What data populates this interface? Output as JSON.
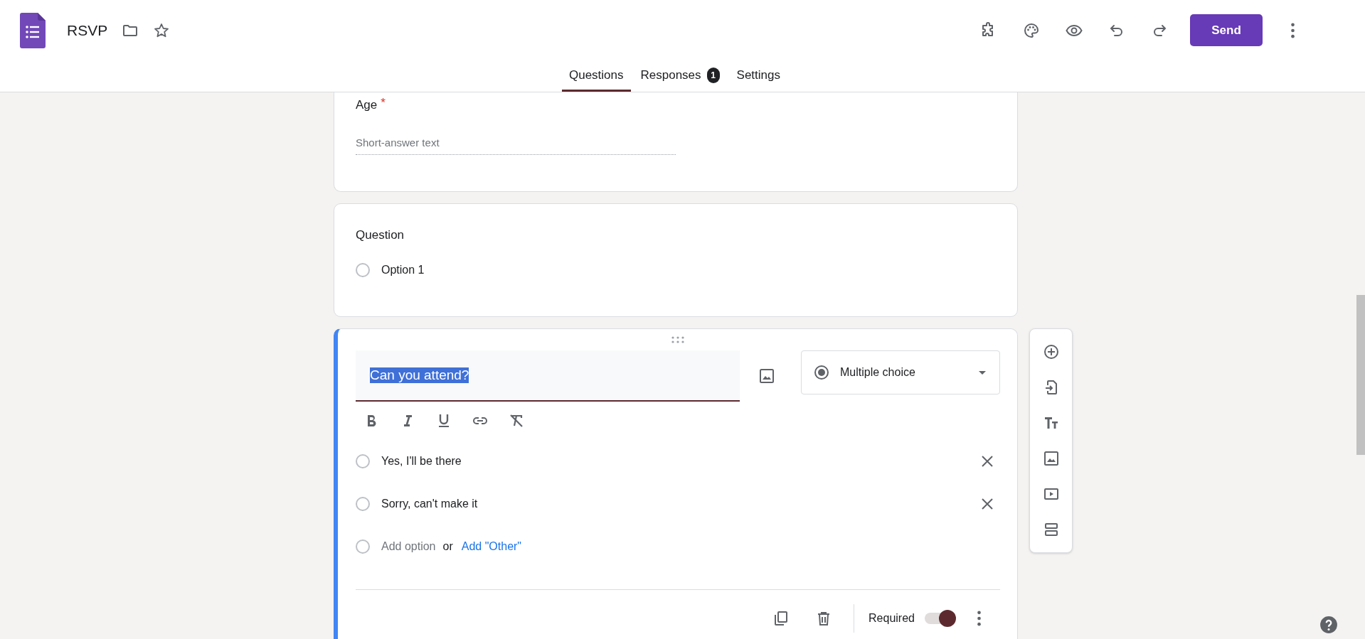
{
  "app": {
    "title": "RSVP"
  },
  "toolbar": {
    "send_label": "Send"
  },
  "tabs": [
    {
      "label": "Questions",
      "selected": true
    },
    {
      "label": "Responses",
      "selected": false,
      "badge": "1"
    },
    {
      "label": "Settings",
      "selected": false
    }
  ],
  "questions": [
    {
      "kind": "short",
      "title": "Age",
      "required_mark": "*",
      "placeholder": "Short-answer text"
    },
    {
      "kind": "choice",
      "title": "Question",
      "options": [
        {
          "label": "Option 1",
          "selected": false
        }
      ]
    },
    {
      "kind": "editing",
      "title": "Can you attend?",
      "title_selected": true,
      "type_label": "Multiple choice",
      "options": [
        {
          "label": "Yes, I'll be there",
          "selected": false
        },
        {
          "label": "Sorry, can't make it",
          "selected": false
        }
      ],
      "add_option": "Add option",
      "add_option_selected": false,
      "or": "or",
      "add_other": "Add \"Other\"",
      "required_label": "Required",
      "required": true
    }
  ]
}
